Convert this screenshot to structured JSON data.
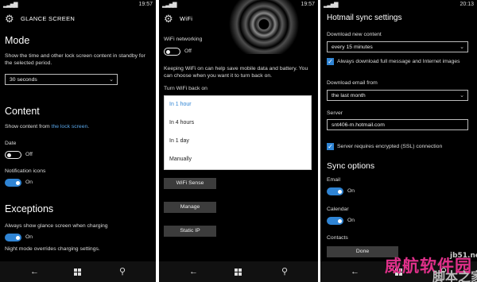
{
  "screen1": {
    "status_time": "19:57",
    "title": "GLANCE SCREEN",
    "mode_heading": "Mode",
    "mode_desc": "Show the time and other lock screen content in standby for the selected period.",
    "mode_select": "30 seconds",
    "content_heading": "Content",
    "content_desc_prefix": "Show content from ",
    "content_desc_link": "the lock screen",
    "content_desc_suffix": ".",
    "date_label": "Date",
    "date_state": "Off",
    "notif_label": "Notification icons",
    "notif_state": "On",
    "exceptions_heading": "Exceptions",
    "charging_label": "Always show glance screen when charging",
    "charging_state": "On",
    "night_text": "Night mode overrides charging settings."
  },
  "screen2": {
    "status_time": "19:57",
    "title": "WiFi",
    "networking_label": "WiFi networking",
    "networking_state": "Off",
    "keeping_desc": "Keeping WiFi on can help save mobile data and battery. You can choose when you want it to turn back on.",
    "turn_back_label": "Turn WiFi back on",
    "options": [
      "In 1 hour",
      "In 4 hours",
      "In 1 day",
      "Manually"
    ],
    "buttons": [
      "WiFi Sense",
      "Manage",
      "Static IP"
    ]
  },
  "screen3": {
    "status_time": "20:13",
    "title": "Hotmail sync settings",
    "download_new_label": "Download new content",
    "download_new_select": "every 15 minutes",
    "always_download_label": "Always download full message and Internet images",
    "download_from_label": "Download email from",
    "download_from_select": "the last month",
    "server_label": "Server",
    "server_value": "snt406-m.hotmail.com",
    "ssl_label": "Server requires encrypted (SSL) connection",
    "sync_heading": "Sync options",
    "email_label": "Email",
    "email_state": "On",
    "calendar_label": "Calendar",
    "calendar_state": "On",
    "contacts_label": "Contacts",
    "done_button": "Done"
  },
  "watermark": {
    "line1": "威航软件园",
    "line2": "脚本之家",
    "line3": "jb51.net"
  },
  "colors": {
    "accent": "#2f84d4",
    "link": "#5aa6e8",
    "background": "#000000"
  }
}
